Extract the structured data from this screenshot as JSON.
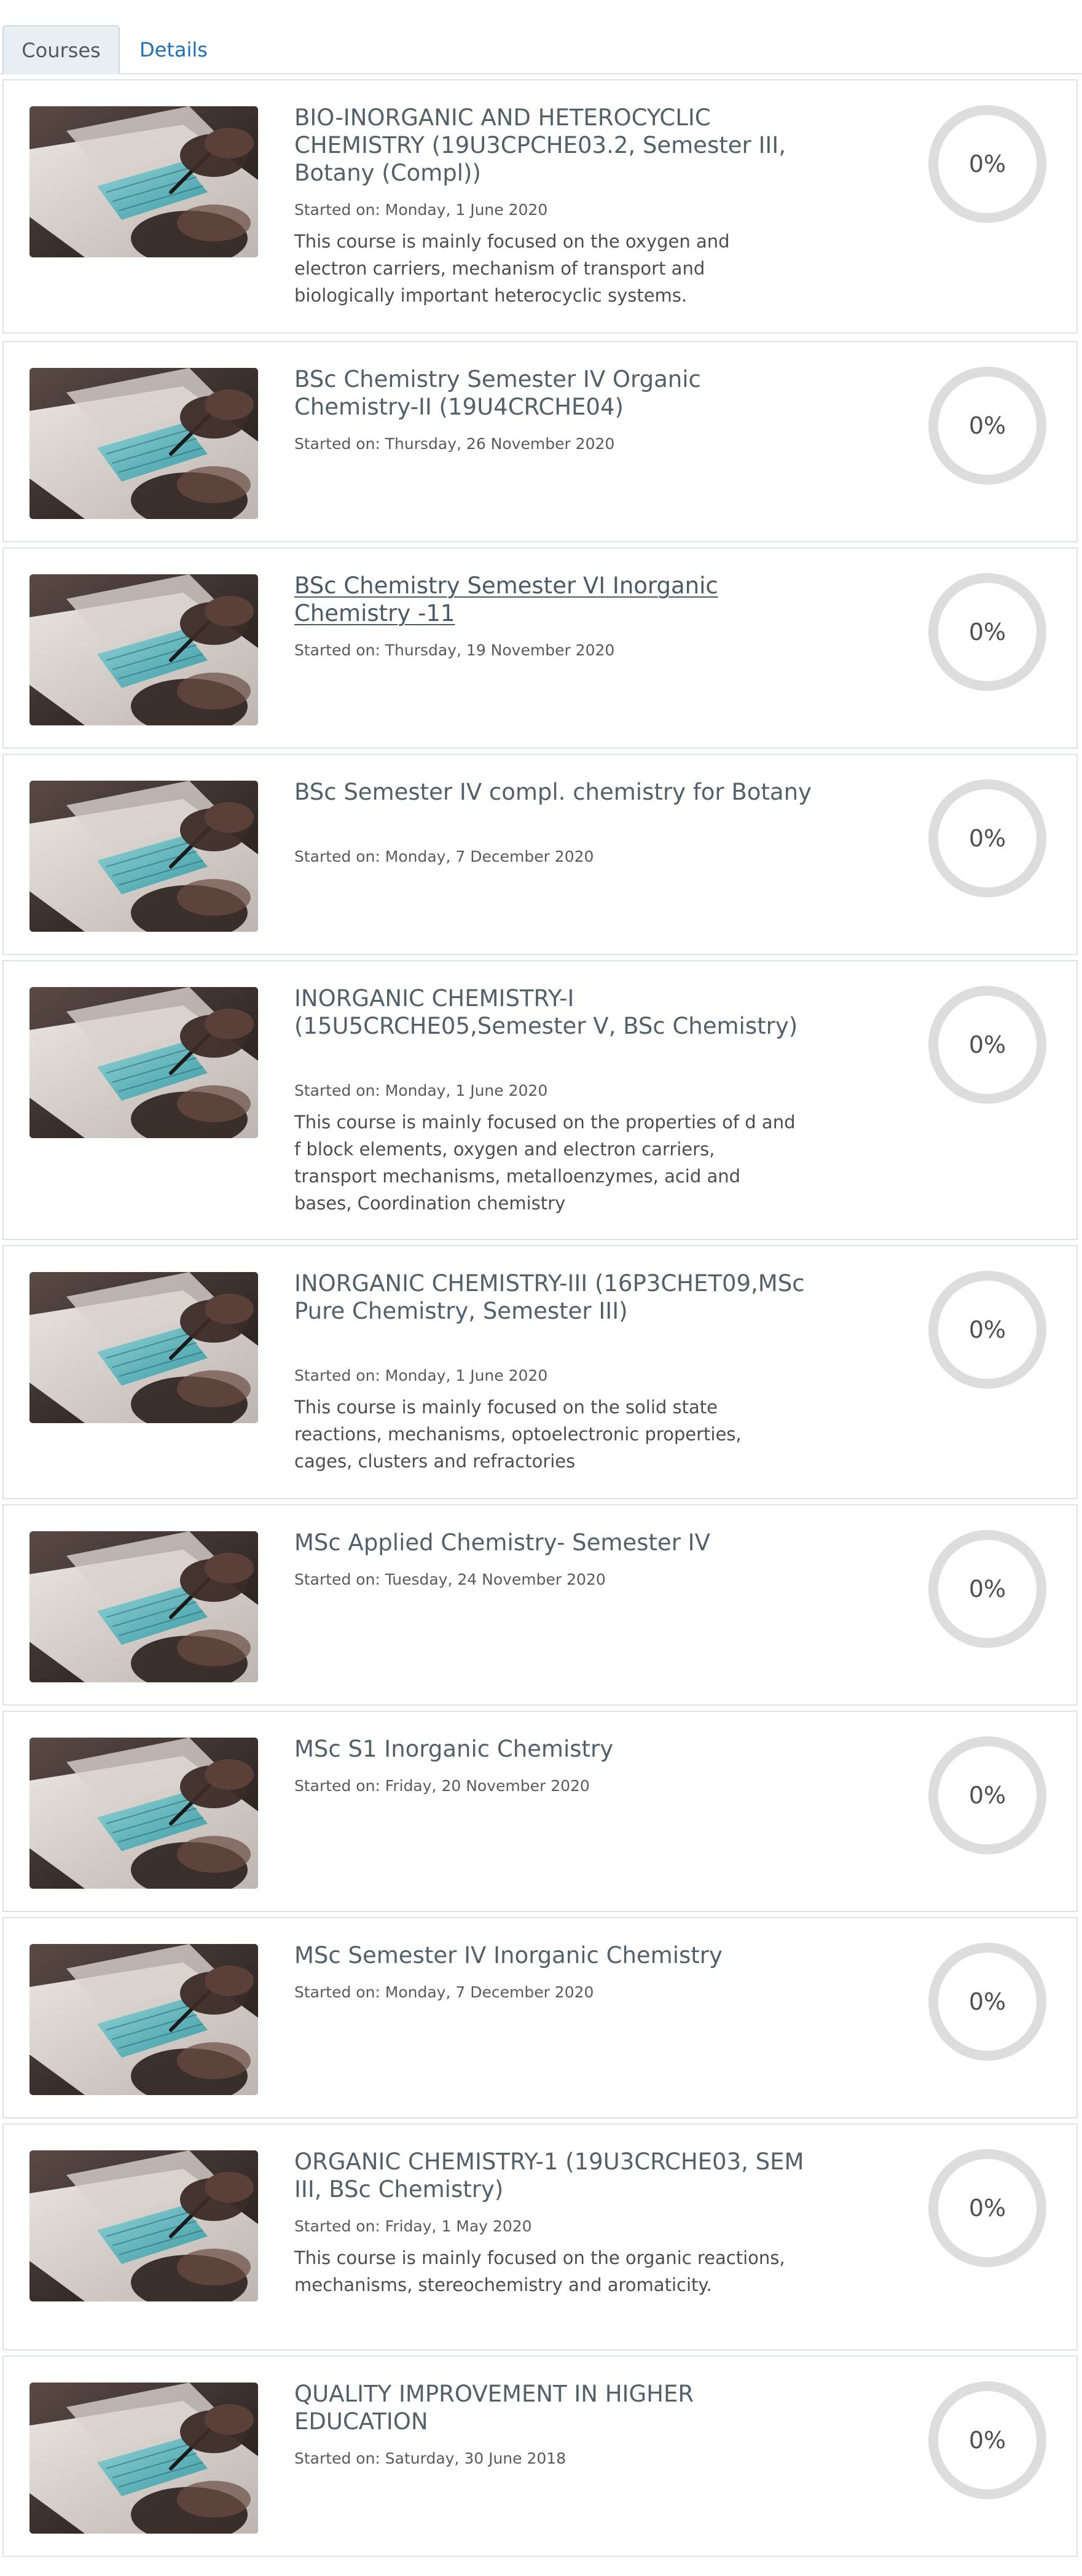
{
  "tabs": [
    {
      "label": "Courses"
    },
    {
      "label": "Details"
    }
  ],
  "courses": [
    {
      "title": "BIO-INORGANIC AND HETEROCYCLIC CHEMISTRY (19U3CPCHE03.2, Semester III, Botany (Compl))",
      "started": "Started on: Monday, 1 June 2020",
      "description": "This course is mainly focused on the oxygen and electron carriers, mechanism of transport and biologically important heterocyclic systems.",
      "progress": "0%"
    },
    {
      "title": "BSc Chemistry Semester IV Organic Chemistry-II (19U4CRCHE04)",
      "started": "Started on: Thursday, 26 November 2020",
      "description": "",
      "progress": "0%"
    },
    {
      "title": "BSc Chemistry Semester VI Inorganic Chemistry -11",
      "started": "Started on: Thursday, 19 November 2020",
      "description": "",
      "progress": "0%"
    },
    {
      "title": "BSc Semester IV compl. chemistry for Botany",
      "started": "Started on: Monday, 7 December 2020",
      "description": "",
      "progress": "0%"
    },
    {
      "title": "INORGANIC CHEMISTRY-I (15U5CRCHE05,Semester V, BSc Chemistry)",
      "started": "Started on: Monday, 1 June 2020",
      "description": "This course is mainly focused on  the properties of  d and f block elements, oxygen and electron carriers, transport mechanisms, metalloenzymes, acid and bases, Coordination chemistry",
      "progress": "0%"
    },
    {
      "title": "INORGANIC CHEMISTRY-III (16P3CHET09,MSc Pure Chemistry, Semester III)",
      "started": "Started on: Monday, 1 June 2020",
      "description": "This course is mainly focused on the solid state reactions, mechanisms, optoelectronic properties, cages, clusters and refractories",
      "progress": "0%"
    },
    {
      "title": "MSc Applied Chemistry- Semester IV",
      "started": "Started on: Tuesday, 24 November 2020",
      "description": "",
      "progress": "0%"
    },
    {
      "title": "MSc S1 Inorganic Chemistry",
      "started": "Started on: Friday, 20 November 2020",
      "description": "",
      "progress": "0%"
    },
    {
      "title": "MSc Semester IV Inorganic Chemistry",
      "started": "Started on: Monday, 7 December 2020",
      "description": "",
      "progress": "0%"
    },
    {
      "title": "ORGANIC CHEMISTRY-1 (19U3CRCHE03, SEM III, BSc Chemistry)",
      "started": "Started on: Friday, 1 May 2020",
      "description": "This course is mainly focused on the organic reactions, mechanisms, stereochemistry  and aromaticity.",
      "progress": "0%"
    },
    {
      "title": "QUALITY IMPROVEMENT IN HIGHER EDUCATION",
      "started": "Started on: Saturday, 30 June 2018",
      "description": "",
      "progress": "0%"
    }
  ],
  "colors": {
    "title": "#526069",
    "link": "#1f6fb5",
    "progress_ring": "#dddddd"
  }
}
